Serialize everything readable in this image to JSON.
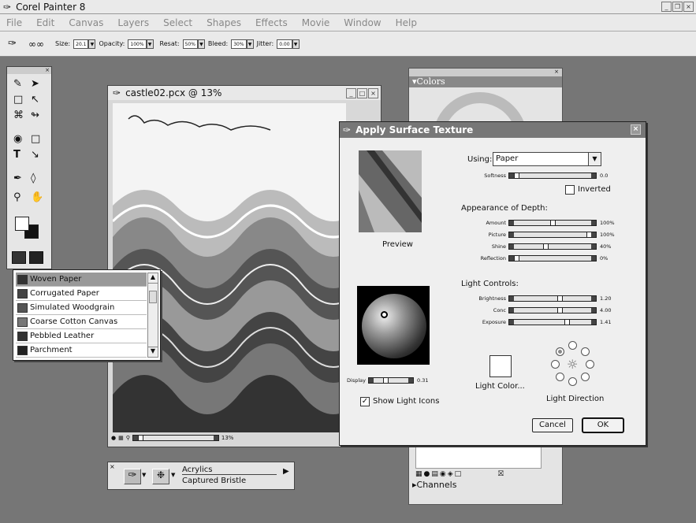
{
  "app": {
    "title": "Corel Painter 8"
  },
  "menu": [
    "File",
    "Edit",
    "Canvas",
    "Layers",
    "Select",
    "Shapes",
    "Effects",
    "Movie",
    "Window",
    "Help"
  ],
  "propbar": {
    "size_label": "Size:",
    "size_value": "20.1",
    "opacity_label": "Opacity:",
    "opacity_value": "100%",
    "resat_label": "Resat:",
    "resat_value": "50%",
    "bleed_label": "Bleed:",
    "bleed_value": "30%",
    "jitter_label": "Jitter:",
    "jitter_value": "0.00"
  },
  "document": {
    "title": "castle02.pcx @ 13%",
    "zoom": "13%"
  },
  "paper_list": {
    "items": [
      "Woven Paper",
      "Corrugated Paper",
      "Simulated Woodgrain",
      "Coarse Cotton Canvas",
      "Pebbled Leather",
      "Parchment"
    ],
    "selected": 0
  },
  "colors_panel": {
    "title": "Colors"
  },
  "channels_panel": {
    "title": "Channels"
  },
  "dialog": {
    "title": "Apply Surface Texture",
    "preview_label": "Preview",
    "using_label": "Using:",
    "using_value": "Paper",
    "softness_label": "Softness",
    "softness_value": "0.0",
    "inverted_label": "Inverted",
    "depth_heading": "Appearance of Depth:",
    "depth": [
      {
        "label": "Amount",
        "value": "100%",
        "pos": 0.5
      },
      {
        "label": "Picture",
        "value": "100%",
        "pos": 1.0
      },
      {
        "label": "Shine",
        "value": "40%",
        "pos": 0.4
      },
      {
        "label": "Reflection",
        "value": "0%",
        "pos": 0.0
      }
    ],
    "light_heading": "Light Controls:",
    "light": [
      {
        "label": "Brightness",
        "value": "1.20",
        "pos": 0.6
      },
      {
        "label": "Conc",
        "value": "4.00",
        "pos": 0.6
      },
      {
        "label": "Exposure",
        "value": "1.41",
        "pos": 0.7
      }
    ],
    "display_label": "Display",
    "display_value": "0.31",
    "show_icons_label": "Show Light Icons",
    "light_color_label": "Light Color...",
    "light_direction_label": "Light Direction",
    "cancel_label": "Cancel",
    "ok_label": "OK"
  },
  "brush_selector": {
    "category": "Acrylics",
    "variant": "Captured Bristle"
  }
}
